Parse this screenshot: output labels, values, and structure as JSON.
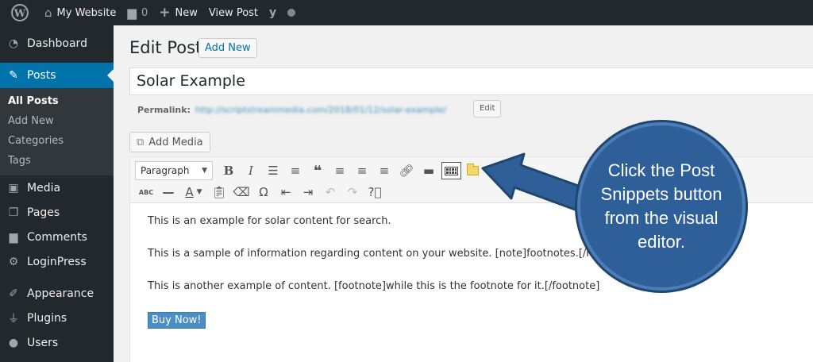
{
  "adminbar": {
    "site_name": "My Website",
    "comments_count": "0",
    "new_label": "New",
    "view_post_label": "View Post"
  },
  "sidebar": {
    "items": [
      {
        "label": "Dashboard",
        "icon": "dashboard-icon"
      },
      {
        "label": "Posts",
        "icon": "pushpin-icon"
      },
      {
        "label": "Media",
        "icon": "media-icon"
      },
      {
        "label": "Pages",
        "icon": "pages-icon"
      },
      {
        "label": "Comments",
        "icon": "comments-icon"
      },
      {
        "label": "LoginPress",
        "icon": "gear-icon"
      },
      {
        "label": "Appearance",
        "icon": "paintbrush-icon"
      },
      {
        "label": "Plugins",
        "icon": "plugin-icon"
      },
      {
        "label": "Users",
        "icon": "users-icon"
      }
    ],
    "posts_submenu": [
      "All Posts",
      "Add New",
      "Categories",
      "Tags"
    ]
  },
  "main": {
    "page_title": "Edit Post",
    "add_new_label": "Add New",
    "post_title": "Solar Example",
    "permalink_label": "Permalink:",
    "permalink_url": "http://scriptstreammedia.com/2018/01/12/solar-example/",
    "edit_label": "Edit",
    "add_media_label": "Add Media",
    "format_select": "Paragraph",
    "content": [
      "This is an example for solar content for search.",
      "This is a sample of information regarding content on your website. [note]footnotes.[/note]",
      "This is another example of content. [footnote]while this is the footnote for it.[/footnote]"
    ],
    "buy_button_label": "Buy Now!"
  },
  "callout": {
    "text": "Click the Post Snippets button from the visual editor.",
    "color": "#2f5f99"
  }
}
